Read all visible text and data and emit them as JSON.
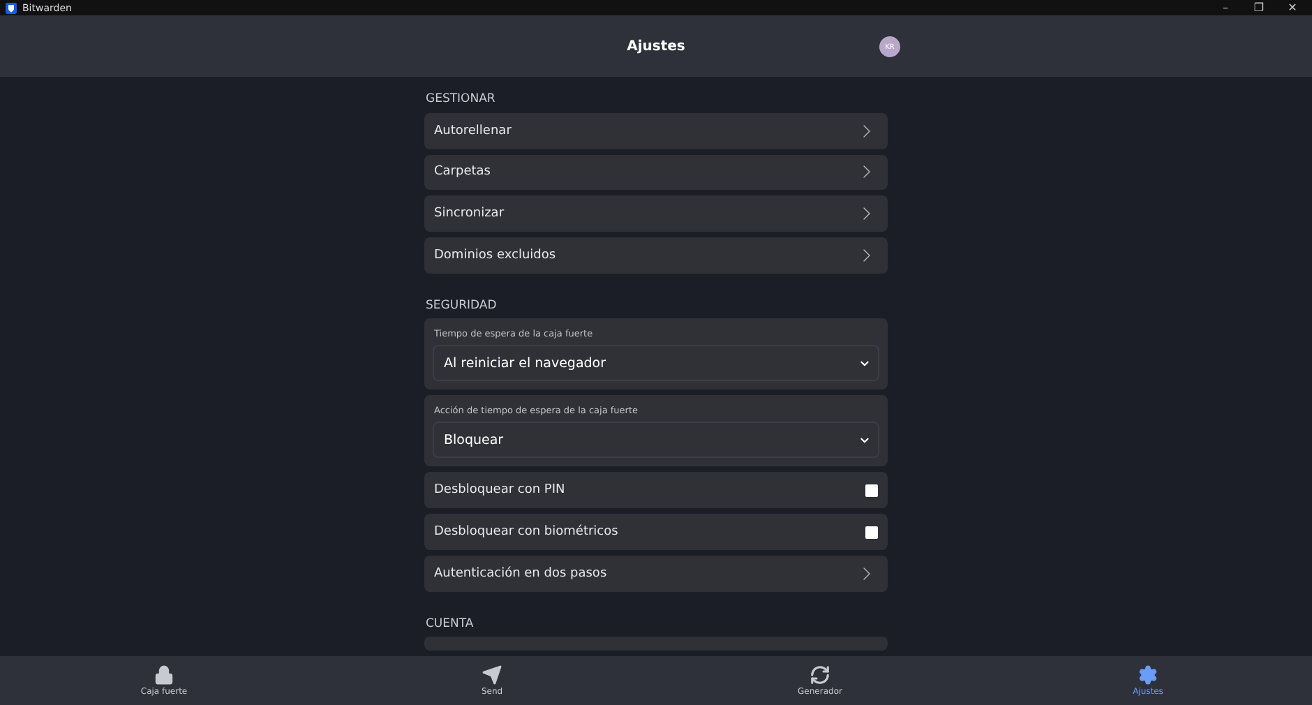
{
  "window": {
    "title": "Bitwarden",
    "controls": [
      "–",
      "❐",
      "✕"
    ]
  },
  "header": {
    "title": "Ajustes",
    "avatar": "KR"
  },
  "sections": [
    {
      "title": "GESTIONAR",
      "items": [
        {
          "kind": "link",
          "label": "Autorellenar"
        },
        {
          "kind": "link",
          "label": "Carpetas"
        },
        {
          "kind": "link",
          "label": "Sincronizar"
        },
        {
          "kind": "link",
          "label": "Dominios excluidos"
        }
      ]
    },
    {
      "title": "SEGURIDAD",
      "items": [
        {
          "kind": "select",
          "label": "Tiempo de espera de la caja fuerte",
          "value": "Al reiniciar el navegador"
        },
        {
          "kind": "select",
          "label": "Acción de tiempo de espera de la caja fuerte",
          "value": "Bloquear"
        },
        {
          "kind": "checkbox",
          "label": "Desbloquear con PIN",
          "checked": false
        },
        {
          "kind": "checkbox",
          "label": "Desbloquear con biométricos",
          "checked": false
        },
        {
          "kind": "link",
          "label": "Autenticación en dos pasos"
        }
      ]
    },
    {
      "title": "CUENTA",
      "items": [
        {
          "kind": "partial"
        }
      ]
    }
  ],
  "nav": [
    {
      "label": "Caja fuerte",
      "selected": false
    },
    {
      "label": "Send",
      "selected": false
    },
    {
      "label": "Generador",
      "selected": false
    },
    {
      "label": "Ajustes",
      "selected": true
    }
  ]
}
